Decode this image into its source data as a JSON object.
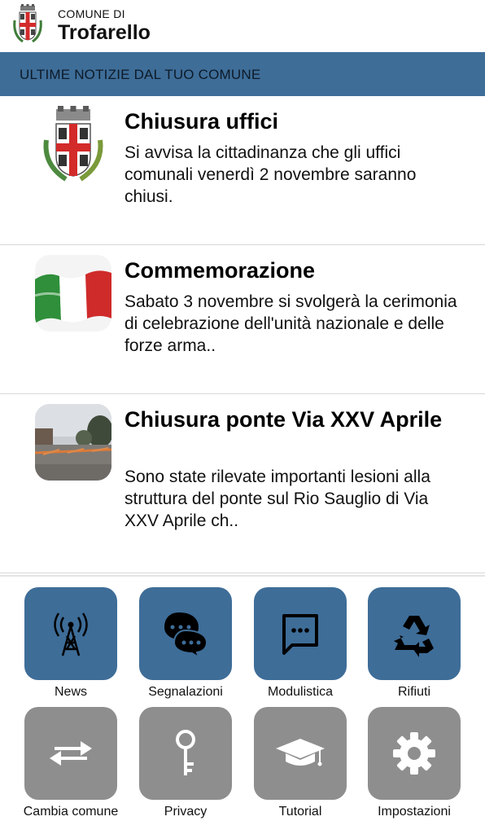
{
  "header": {
    "comune_label": "COMUNE DI",
    "comune_name": "Trofarello"
  },
  "banner": {
    "title": "ULTIME NOTIZIE DAL TUO COMUNE"
  },
  "news": [
    {
      "title": "Chiusura uffici",
      "text": "Si avvisa la cittadinanza che gli uffici comunali venerdì 2 novembre saranno chiusi.",
      "thumb_icon": "crest-icon"
    },
    {
      "title": "Commemorazione",
      "text": "Sabato 3 novembre si svolgerà la cerimonia di celebrazione dell'unità nazionale e delle forze arma..",
      "thumb_icon": "italian-flag-icon"
    },
    {
      "title": "Chiusura ponte Via XXV Aprile",
      "text": "Sono state rilevate importanti lesioni alla struttura del ponte sul Rio Sauglio di Via XXV Aprile ch..",
      "thumb_icon": "bridge-photo-icon"
    }
  ],
  "menu": [
    {
      "label": "News",
      "icon": "antenna-icon"
    },
    {
      "label": "Segnalazioni",
      "icon": "chat-bubbles-icon"
    },
    {
      "label": "Modulistica",
      "icon": "message-dots-icon"
    },
    {
      "label": "Rifiuti",
      "icon": "recycle-icon"
    },
    {
      "label": "Cambia comune",
      "icon": "swap-arrows-icon"
    },
    {
      "label": "Privacy",
      "icon": "key-icon"
    },
    {
      "label": "Tutorial",
      "icon": "graduation-cap-icon"
    },
    {
      "label": "Impostazioni",
      "icon": "gear-icon"
    }
  ],
  "colors": {
    "accent": "#3e6d98",
    "tile_gray": "#8e8e8e"
  }
}
